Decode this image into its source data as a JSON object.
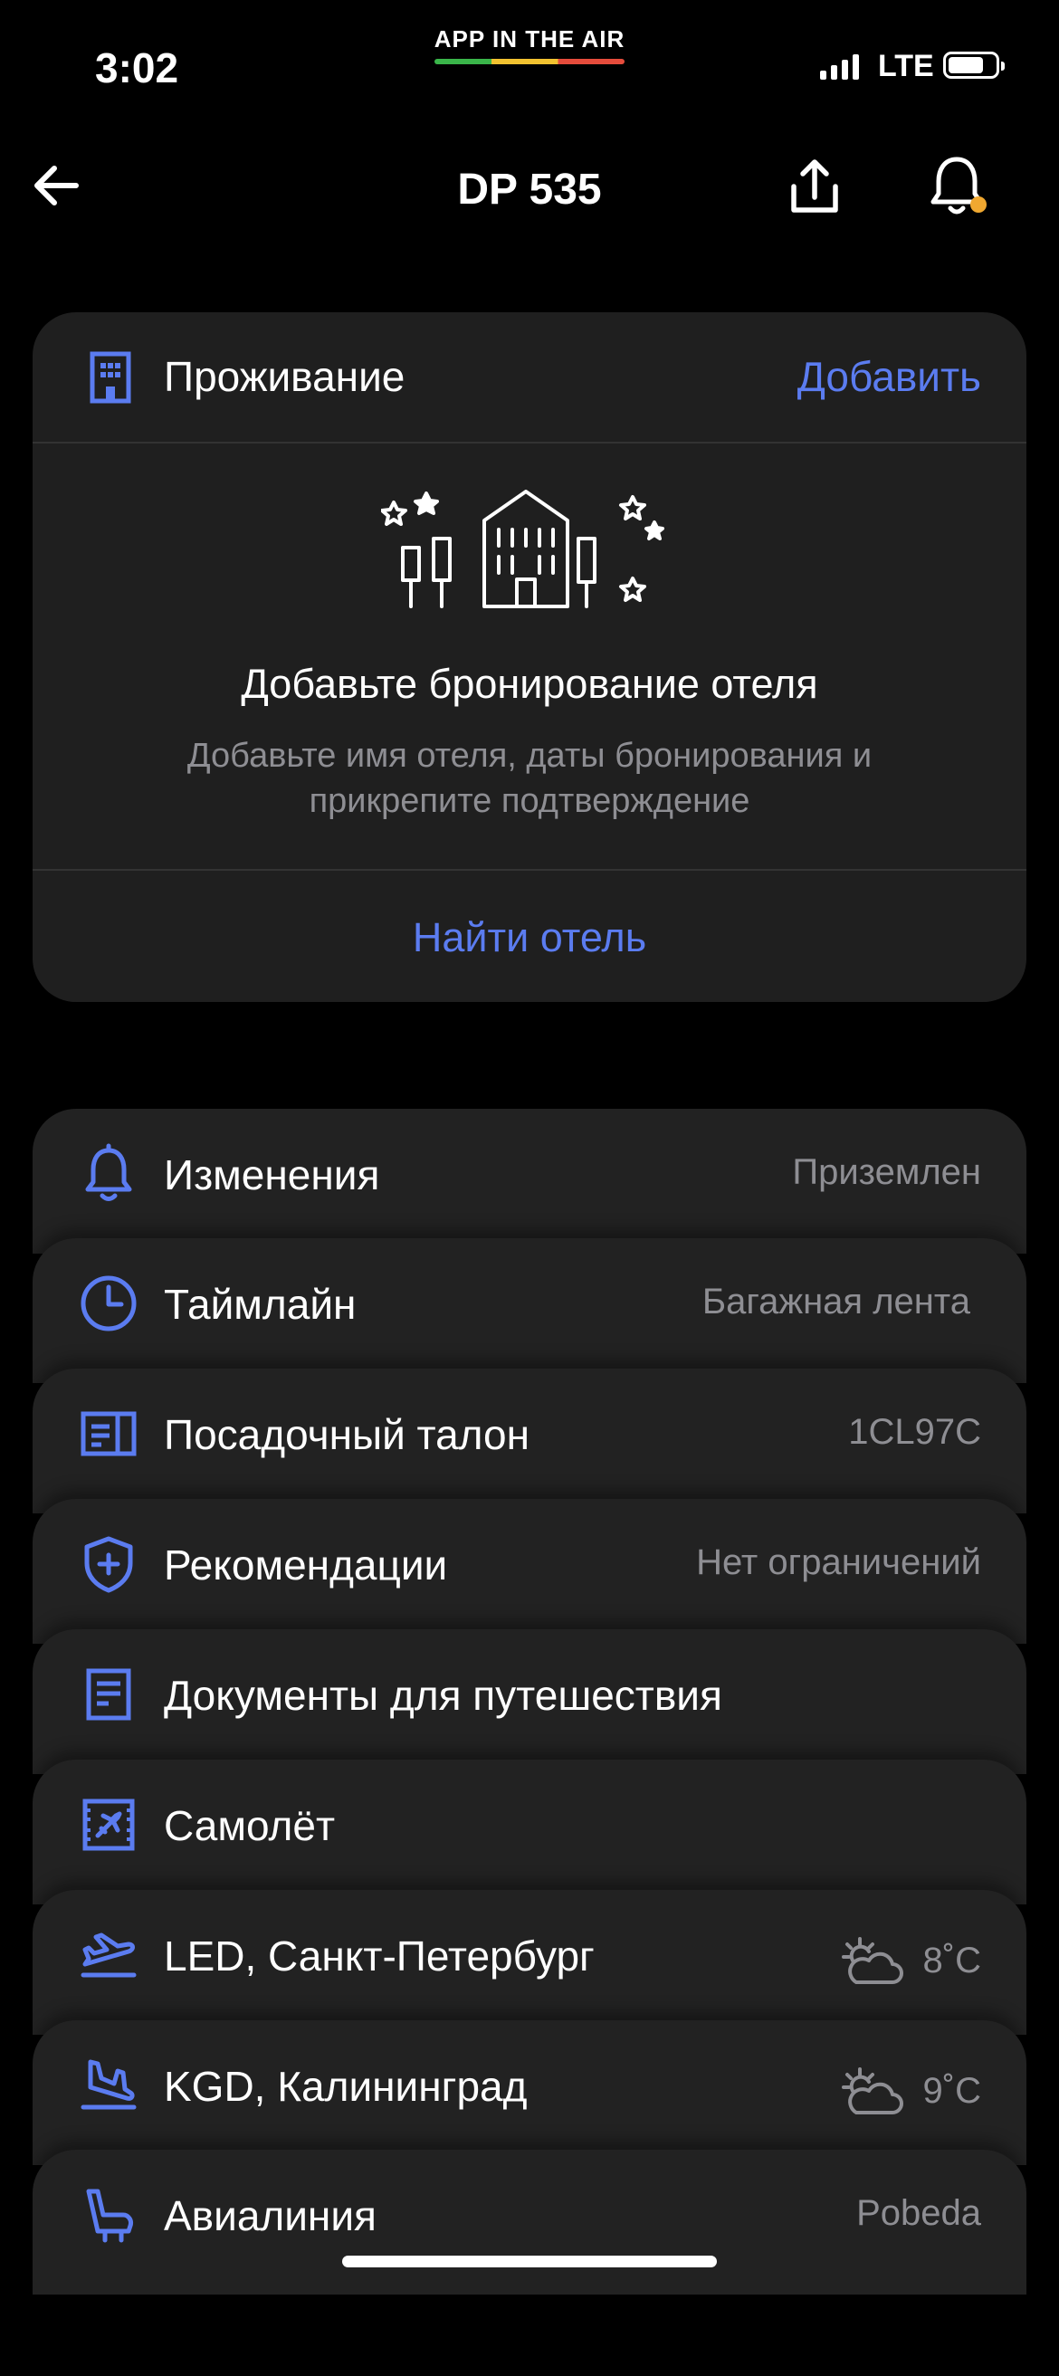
{
  "status": {
    "time": "3:02",
    "brand": "APP IN THE AIR",
    "network": "LTE"
  },
  "nav": {
    "title": "DP 535",
    "icons": [
      "back-arrow-icon",
      "share-icon",
      "bell-icon"
    ],
    "notification_dot_color": "#f0a830"
  },
  "accommodation": {
    "title": "Проживание",
    "add_label": "Добавить",
    "heading": "Добавьте бронирование отеля",
    "description": "Добавьте имя отеля, даты бронирования и прикрепите подтверждение",
    "find_label": "Найти отель"
  },
  "rows": [
    {
      "icon": "bell-icon",
      "label": "Изменения",
      "value": "Приземлен"
    },
    {
      "icon": "clock-icon",
      "label": "Таймлайн",
      "value": "Багажная лента"
    },
    {
      "icon": "boarding-pass-icon",
      "label": "Посадочный талон",
      "value": "1CL97C"
    },
    {
      "icon": "shield-plus-icon",
      "label": "Рекомендации",
      "value": "Нет ограничений"
    },
    {
      "icon": "document-icon",
      "label": "Документы для путешествия",
      "value": ""
    },
    {
      "icon": "aircraft-icon",
      "label": "Самолёт",
      "value": ""
    },
    {
      "icon": "takeoff-icon",
      "label": "LED, Санкт-Петербург",
      "temp": "8˚C",
      "weather_icon": "partly-cloudy-icon"
    },
    {
      "icon": "landing-icon",
      "label": "KGD, Калининград",
      "temp": "9˚C",
      "weather_icon": "partly-cloudy-icon"
    },
    {
      "icon": "airline-seat-icon",
      "label": "Авиалиния",
      "value": "Pobeda"
    }
  ],
  "colors": {
    "accent": "#5b7cf0",
    "background": "#000000",
    "card": "#1f1f1f",
    "secondary_text": "#8e8e93"
  }
}
